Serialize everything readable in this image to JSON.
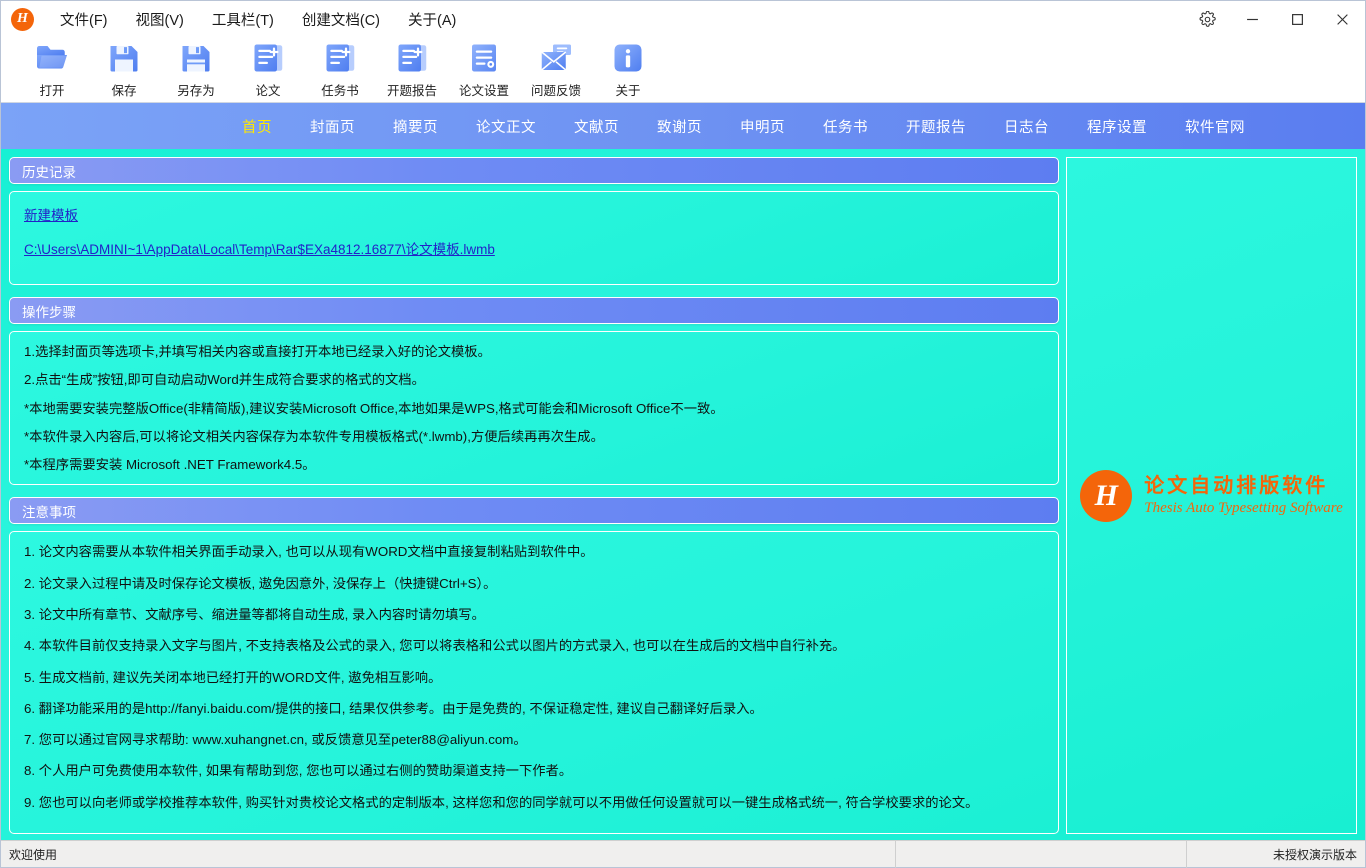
{
  "window": {
    "logo_letter": "H",
    "menus": [
      {
        "label": "文件(F)",
        "name": "menu-file"
      },
      {
        "label": "视图(V)",
        "name": "menu-view"
      },
      {
        "label": "工具栏(T)",
        "name": "menu-toolbar"
      },
      {
        "label": "创建文档(C)",
        "name": "menu-create-document"
      },
      {
        "label": "关于(A)",
        "name": "menu-about"
      }
    ],
    "controls": {
      "settings": "gear-icon",
      "minimize": "minimize-icon",
      "maximize": "maximize-icon",
      "close": "close-icon"
    }
  },
  "toolbar": {
    "buttons": [
      {
        "label": "打开",
        "icon": "folder-open-icon"
      },
      {
        "label": "保存",
        "icon": "save-floppy-icon"
      },
      {
        "label": "另存为",
        "icon": "save-as-floppy-icon"
      },
      {
        "label": "论文",
        "icon": "document-add-icon"
      },
      {
        "label": "任务书",
        "icon": "document-add-icon"
      },
      {
        "label": "开题报告",
        "icon": "document-add-icon"
      },
      {
        "label": "论文设置",
        "icon": "document-settings-icon"
      },
      {
        "label": "问题反馈",
        "icon": "envelope-feedback-icon"
      },
      {
        "label": "关于",
        "icon": "info-icon"
      }
    ]
  },
  "nav": {
    "active_index": 0,
    "items": [
      "首页",
      "封面页",
      "摘要页",
      "论文正文",
      "文献页",
      "致谢页",
      "申明页",
      "任务书",
      "开题报告",
      "日志台",
      "程序设置",
      "软件官网"
    ]
  },
  "history": {
    "title": "历史记录",
    "links": [
      "新建模板",
      "C:\\Users\\ADMINI~1\\AppData\\Local\\Temp\\Rar$EXa4812.16877\\论文模板.lwmb"
    ]
  },
  "steps": {
    "title": "操作步骤",
    "lines": [
      "1.选择封面页等选项卡,并填写相关内容或直接打开本地已经录入好的论文模板。",
      "2.点击“生成”按钮,即可自动启动Word并生成符合要求的格式的文档。",
      "*本地需要安装完整版Office(非精简版),建议安装Microsoft Office,本地如果是WPS,格式可能会和Microsoft Office不一致。",
      "*本软件录入内容后,可以将论文相关内容保存为本软件专用模板格式(*.lwmb),方便后续再再次生成。",
      "*本程序需要安装 Microsoft .NET Framework4.5。"
    ]
  },
  "notes": {
    "title": "注意事项",
    "lines": [
      "1. 论文内容需要从本软件相关界面手动录入, 也可以从现有WORD文档中直接复制粘贴到软件中。",
      "2. 论文录入过程中请及时保存论文模板, 遨免因意外, 没保存上（快捷键Ctrl+S）。",
      "3. 论文中所有章节、文献序号、缩进量等都将自动生成, 录入内容时请勿填写。",
      "4. 本软件目前仅支持录入文字与图片, 不支持表格及公式的录入, 您可以将表格和公式以图片的方式录入, 也可以在生成后的文档中自行补充。",
      "5. 生成文档前, 建议先关闭本地已经打开的WORD文件, 遨免相互影响。",
      "6. 翻译功能采用的是http://fanyi.baidu.com/提供的接口, 结果仅供参考。由于是免费的, 不保证稳定性, 建议自己翻译好后录入。",
      "7. 您可以通过官网寻求帮助: www.xuhangnet.cn, 或反馈意见至peter88@aliyun.com。",
      "8. 个人用户可免费使用本软件, 如果有帮助到您, 您也可以通过右侧的赞助渠道支持一下作者。",
      "9. 您也可以向老师或学校推荐本软件, 购买针对贵校论文格式的定制版本, 这样您和您的同学就可以不用做任何设置就可以一键生成格式统一, 符合学校要求的论文。"
    ]
  },
  "brand": {
    "letter": "H",
    "cn": "论文自动排版软件",
    "en": "Thesis Auto Typesetting Software",
    "color": "#f4650a"
  },
  "statusbar": {
    "left": "欢迎使用",
    "right": "未授权演示版本"
  },
  "colors": {
    "nav_blue": "#6e92f2",
    "content_cyan": "#22f2d8",
    "header_gradient_start": "#8a9bf3",
    "header_gradient_end": "#5d7df1",
    "link": "#2222c8",
    "active_tab": "#ffe800",
    "brand_orange": "#f4650a"
  }
}
